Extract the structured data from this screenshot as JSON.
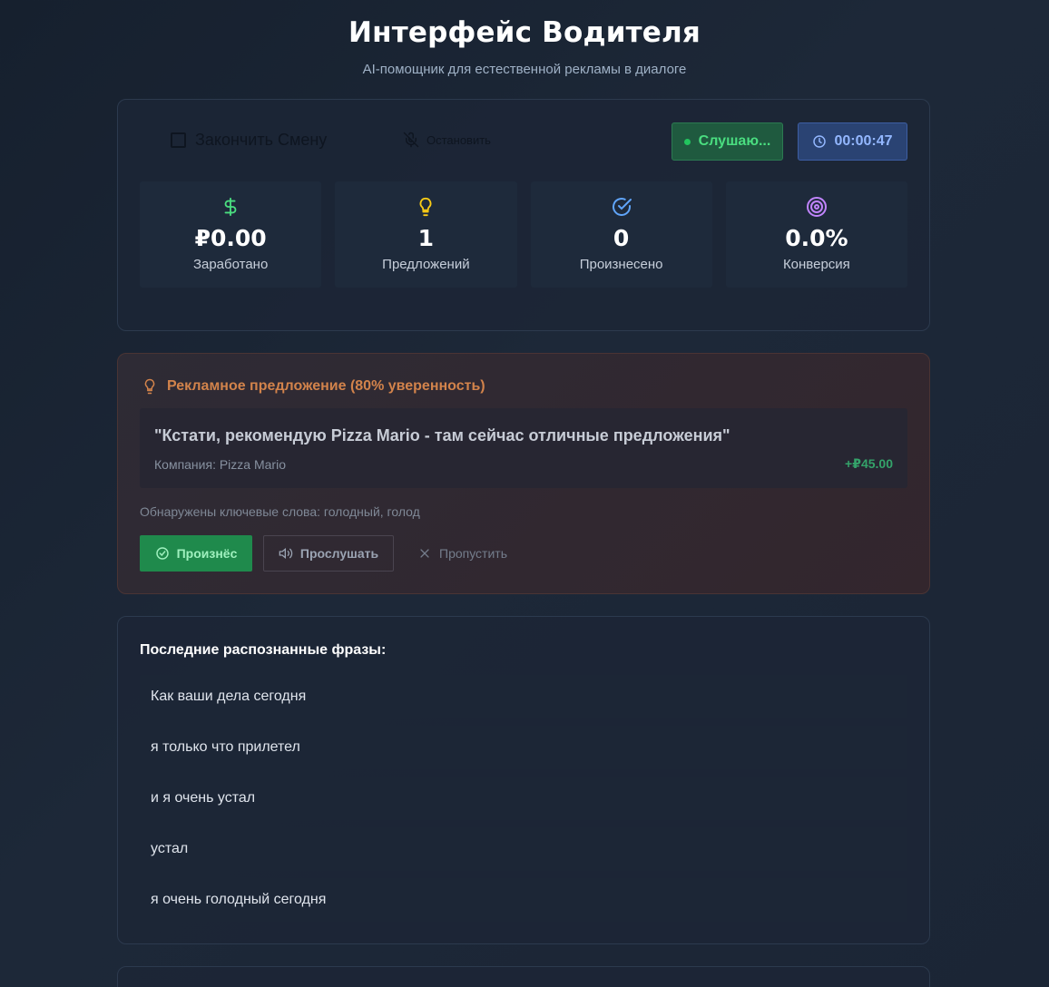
{
  "header": {
    "title": "Интерфейс Водителя",
    "subtitle": "AI-помощник для естественной рекламы в диалоге"
  },
  "controls": {
    "end_shift_label": "Закончить Смену",
    "stop_label": "Остановить",
    "status_label": "Слушаю...",
    "timer": "00:00:47"
  },
  "stats": [
    {
      "icon": "dollar-icon",
      "value": "₽0.00",
      "label": "Заработано",
      "color": "#4ade80"
    },
    {
      "icon": "lightbulb-icon",
      "value": "1",
      "label": "Предложений",
      "color": "#facc15"
    },
    {
      "icon": "check-circle-icon",
      "value": "0",
      "label": "Произнесено",
      "color": "#60a5fa"
    },
    {
      "icon": "target-icon",
      "value": "0.0%",
      "label": "Конверсия",
      "color": "#c084fc"
    }
  ],
  "offer": {
    "heading": "Рекламное предложение (80% уверенность)",
    "text": "\"Кстати, рекомендую Pizza Mario - там сейчас отличные предложения\"",
    "company": "Компания: Pizza Mario",
    "amount": "+₽45.00",
    "keywords": "Обнаружены ключевые слова: голодный, голод",
    "said_label": "Произнёс",
    "listen_label": "Прослушать",
    "skip_label": "Пропустить"
  },
  "phrases": {
    "title": "Последние распознанные фразы:",
    "items": [
      "Как ваши дела сегодня",
      "я только что прилетел",
      "и я очень устал",
      "устал",
      "я очень голодный сегодня"
    ]
  },
  "colors": {
    "accent_green": "#22c55e",
    "accent_blue": "#3d5ea3",
    "offer_orange": "#d2834b"
  }
}
